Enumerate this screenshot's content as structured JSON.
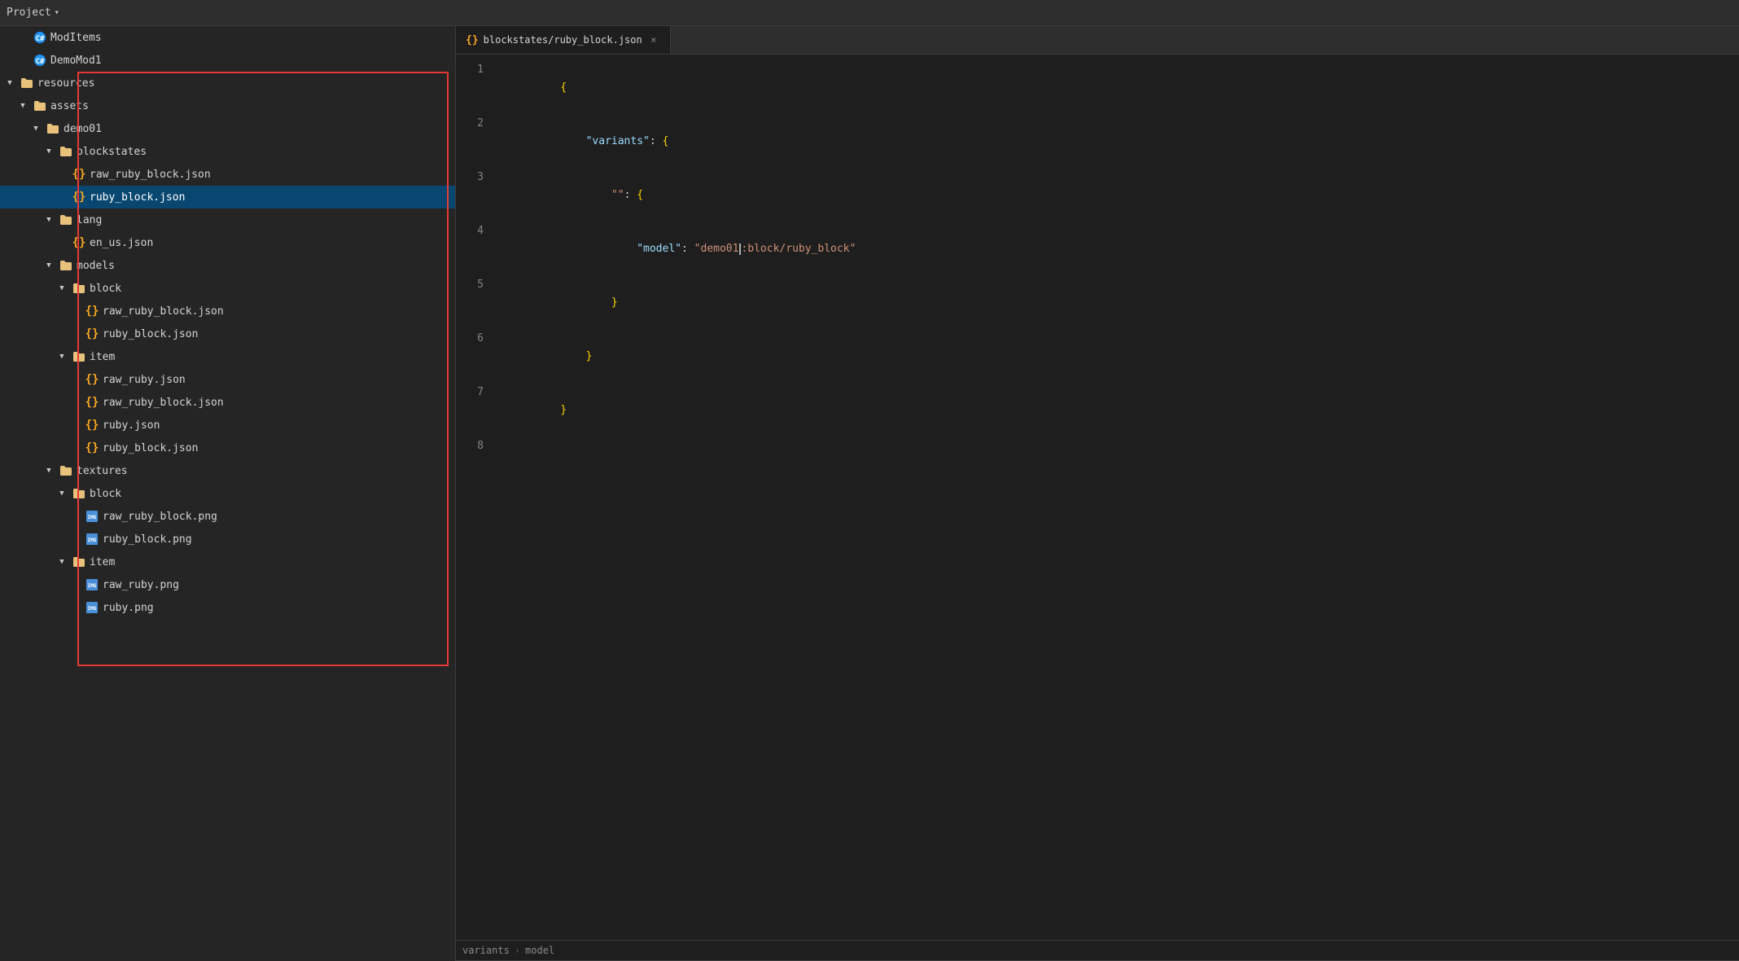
{
  "project": {
    "title": "Project",
    "chevron": "▾"
  },
  "sidebar": {
    "items": [
      {
        "id": "moditems",
        "label": "ModItems",
        "type": "cs-file",
        "indent": 1,
        "has_chevron": false,
        "icon": "cs"
      },
      {
        "id": "demomod1",
        "label": "DemoMod1",
        "type": "cs-file",
        "indent": 1,
        "has_chevron": false,
        "icon": "cs"
      },
      {
        "id": "resources",
        "label": "resources",
        "type": "folder",
        "indent": 0,
        "expanded": true,
        "has_chevron": true
      },
      {
        "id": "assets",
        "label": "assets",
        "type": "folder",
        "indent": 1,
        "expanded": true,
        "has_chevron": true
      },
      {
        "id": "demo01",
        "label": "demo01",
        "type": "folder",
        "indent": 2,
        "expanded": true,
        "has_chevron": true
      },
      {
        "id": "blockstates",
        "label": "blockstates",
        "type": "folder",
        "indent": 3,
        "expanded": true,
        "has_chevron": true
      },
      {
        "id": "raw_ruby_block_json_1",
        "label": "raw_ruby_block.json",
        "type": "json",
        "indent": 4
      },
      {
        "id": "ruby_block_json_1",
        "label": "ruby_block.json",
        "type": "json",
        "indent": 4,
        "selected": true
      },
      {
        "id": "lang",
        "label": "lang",
        "type": "folder",
        "indent": 3,
        "expanded": true,
        "has_chevron": true
      },
      {
        "id": "en_us_json",
        "label": "en_us.json",
        "type": "json",
        "indent": 4
      },
      {
        "id": "models",
        "label": "models",
        "type": "folder",
        "indent": 3,
        "expanded": true,
        "has_chevron": true
      },
      {
        "id": "block_folder",
        "label": "block",
        "type": "folder",
        "indent": 4,
        "expanded": true,
        "has_chevron": true
      },
      {
        "id": "raw_ruby_block_json_2",
        "label": "raw_ruby_block.json",
        "type": "json",
        "indent": 5
      },
      {
        "id": "ruby_block_json_2",
        "label": "ruby_block.json",
        "type": "json",
        "indent": 5
      },
      {
        "id": "item_folder_1",
        "label": "item",
        "type": "folder",
        "indent": 4,
        "expanded": true,
        "has_chevron": true
      },
      {
        "id": "raw_ruby_json",
        "label": "raw_ruby.json",
        "type": "json",
        "indent": 5
      },
      {
        "id": "raw_ruby_block_json_3",
        "label": "raw_ruby_block.json",
        "type": "json",
        "indent": 5
      },
      {
        "id": "ruby_json",
        "label": "ruby.json",
        "type": "json",
        "indent": 5
      },
      {
        "id": "ruby_block_json_3",
        "label": "ruby_block.json",
        "type": "json",
        "indent": 5
      },
      {
        "id": "textures",
        "label": "textures",
        "type": "folder",
        "indent": 3,
        "expanded": true,
        "has_chevron": true
      },
      {
        "id": "block_folder_2",
        "label": "block",
        "type": "folder",
        "indent": 4,
        "expanded": true,
        "has_chevron": true
      },
      {
        "id": "raw_ruby_block_png_1",
        "label": "raw_ruby_block.png",
        "type": "png",
        "indent": 5
      },
      {
        "id": "ruby_block_png",
        "label": "ruby_block.png",
        "type": "png",
        "indent": 5
      },
      {
        "id": "item_folder_2",
        "label": "item",
        "type": "folder",
        "indent": 4,
        "expanded": true,
        "has_chevron": true
      },
      {
        "id": "raw_ruby_png",
        "label": "raw_ruby.png",
        "type": "png",
        "indent": 5
      },
      {
        "id": "ruby_png",
        "label": "ruby.png",
        "type": "png",
        "indent": 5
      }
    ]
  },
  "tab": {
    "filename": "ruby_block.json",
    "path": "blockstates/ruby_block.json"
  },
  "editor": {
    "lines": [
      {
        "num": 1,
        "tokens": [
          {
            "t": "{",
            "c": "c-brace"
          }
        ]
      },
      {
        "num": 2,
        "tokens": [
          {
            "t": "    \"variants\"",
            "c": "c-key"
          },
          {
            "t": ": {",
            "c": "c-brace"
          }
        ]
      },
      {
        "num": 3,
        "tokens": [
          {
            "t": "        \"\"",
            "c": "c-string-key"
          },
          {
            "t": ": {",
            "c": "c-brace"
          }
        ]
      },
      {
        "num": 4,
        "tokens": [
          {
            "t": "            \"model\"",
            "c": "c-key"
          },
          {
            "t": ": ",
            "c": "c-colon"
          },
          {
            "t": "\"demo01",
            "c": "c-string"
          },
          {
            "t": ":block/ruby_block\"",
            "c": "c-string"
          }
        ],
        "cursor_after": 6
      },
      {
        "num": 5,
        "tokens": [
          {
            "t": "        }",
            "c": "c-brace"
          }
        ]
      },
      {
        "num": 6,
        "tokens": [
          {
            "t": "    }",
            "c": "c-brace"
          }
        ]
      },
      {
        "num": 7,
        "tokens": [
          {
            "t": "}",
            "c": "c-brace"
          }
        ]
      },
      {
        "num": 8,
        "tokens": []
      }
    ]
  },
  "breadcrumb": {
    "items": [
      "variants",
      "model"
    ]
  },
  "colors": {
    "selected_bg": "#094771",
    "tab_accent": "#007acc",
    "red_border": "#e53935"
  }
}
